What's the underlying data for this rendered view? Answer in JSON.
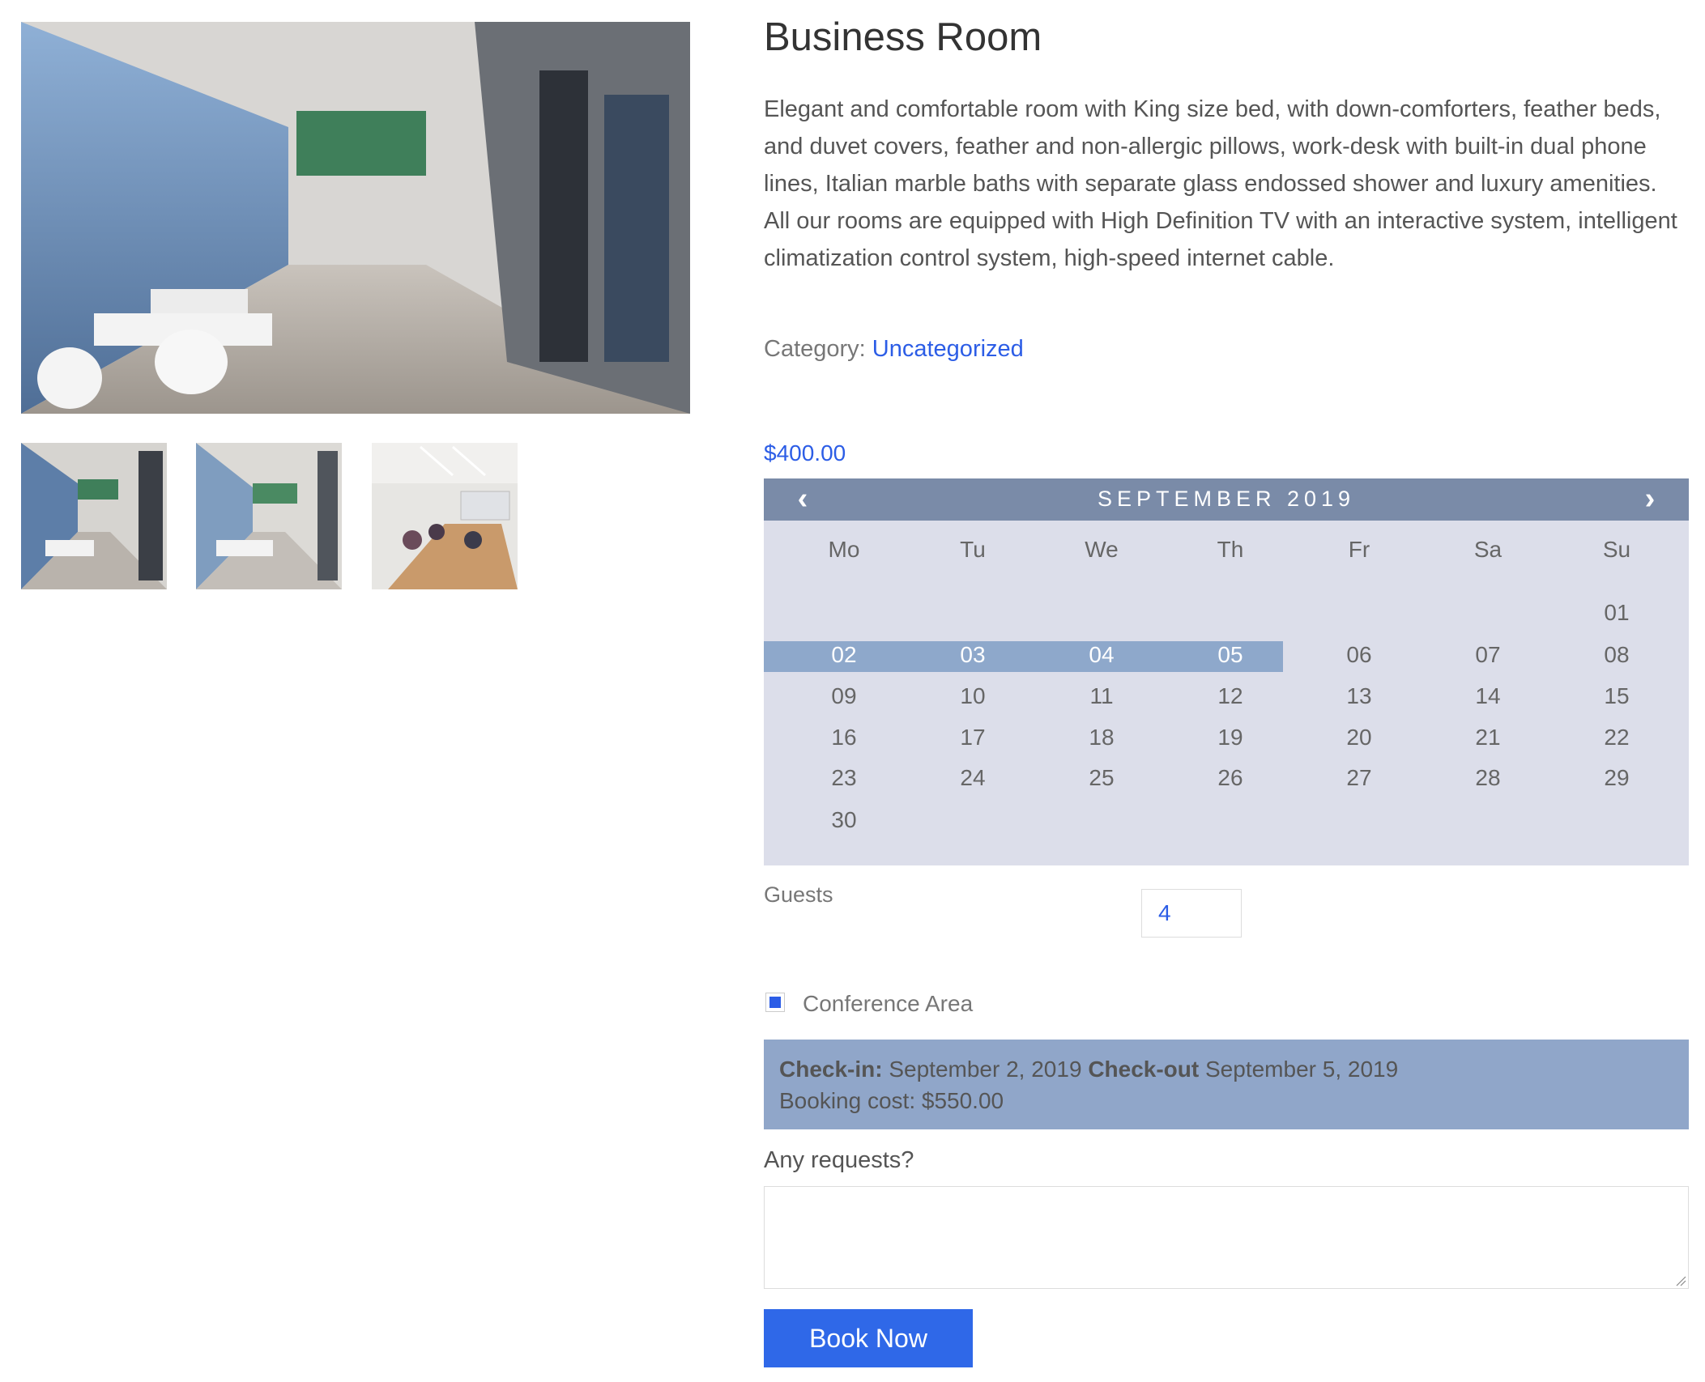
{
  "product": {
    "title": "Business Room",
    "description": "Elegant and comfortable room with King size bed, with down-comforters, feather beds, and duvet covers, feather and non-allergic pillows, work-desk with built-in dual phone lines, Italian marble baths with separate glass endossed shower and luxury amenities. All our rooms are equipped with High Definition TV with an interactive system, intelligent climatization control system, high-speed internet cable.",
    "category_label": "Category:",
    "category_link": "Uncategorized",
    "price": "$400.00"
  },
  "calendar": {
    "month_label": "SEPTEMBER 2019",
    "prev_icon": "‹",
    "next_icon": "›",
    "weekdays": [
      "Mo",
      "Tu",
      "We",
      "Th",
      "Fr",
      "Sa",
      "Su"
    ],
    "weeks": [
      [
        "",
        "",
        "",
        "",
        "",
        "",
        "01"
      ],
      [
        "02",
        "03",
        "04",
        "05",
        "06",
        "07",
        "08"
      ],
      [
        "09",
        "10",
        "11",
        "12",
        "13",
        "14",
        "15"
      ],
      [
        "16",
        "17",
        "18",
        "19",
        "20",
        "21",
        "22"
      ],
      [
        "23",
        "24",
        "25",
        "26",
        "27",
        "28",
        "29"
      ],
      [
        "30",
        "",
        "",
        "",
        "",
        "",
        ""
      ]
    ],
    "selected_days": [
      "02",
      "03",
      "04",
      "05"
    ],
    "colors": {
      "header": "#7a8ba8",
      "body": "#dcdeea",
      "selection": "#8ea8cb"
    }
  },
  "guests": {
    "label": "Guests",
    "value": "4"
  },
  "conference": {
    "label": "Conference Area",
    "checked": true
  },
  "summary": {
    "checkin_label": "Check-in:",
    "checkin_date": "September 2, 2019",
    "checkout_label": "Check-out",
    "checkout_date": "September 5, 2019",
    "cost_text": "Booking cost: $550.00"
  },
  "requests": {
    "label": "Any requests?",
    "value": ""
  },
  "book_button": {
    "label": "Book Now",
    "color": "#2f68e8"
  },
  "icons": {
    "prev": "chevron-left-icon",
    "next": "chevron-right-icon",
    "resize": "resize-grip-icon"
  }
}
